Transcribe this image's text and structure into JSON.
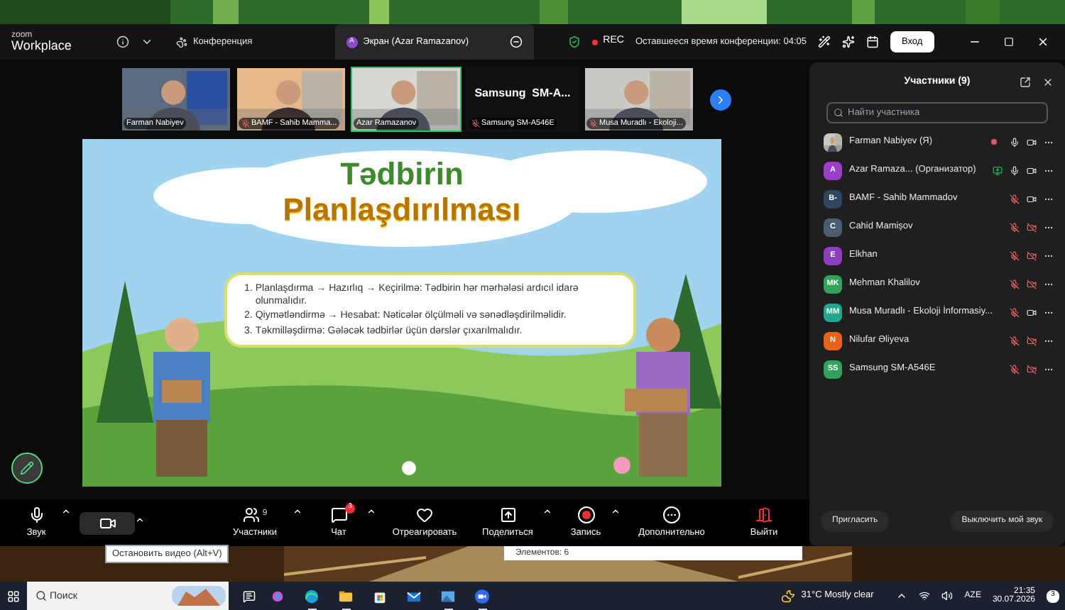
{
  "window": {
    "logo_top": "zoom",
    "logo_bottom": "Workplace",
    "conference_label": "Конференция",
    "share_tab": {
      "avatar": "A",
      "label": "Экран (Azar Ramazanov)"
    },
    "recording": "REC",
    "time_left": "Оставшееся время конференции: 04:05",
    "login_button": "Вход"
  },
  "video_strip": [
    {
      "kind": "video",
      "name": "Farman Nabiyev",
      "muted": false,
      "selected": false
    },
    {
      "kind": "video",
      "name": "BAMF - Sahib Mamma...",
      "muted": true,
      "selected": false
    },
    {
      "kind": "video",
      "name": "Azar Ramazanov",
      "muted": false,
      "selected": true
    },
    {
      "kind": "name_only",
      "title": "Samsung  SM-A...",
      "name": "Samsung SM-A546E",
      "muted": true,
      "selected": false
    },
    {
      "kind": "video",
      "name": "Musa Muradlı - Ekoloji...",
      "muted": true,
      "selected": false
    }
  ],
  "slide": {
    "title_line1": "Tədbirin",
    "title_line2": "Planlaşdırılması",
    "items": [
      {
        "number": "1.",
        "text": "Planlaşdırma → Hazırlıq → Keçirilmə: Tədbirin hər mərhələsi ardıcıl idarə olunmalıdır."
      },
      {
        "number": "2.",
        "text": "Qiymətləndirmə → Hesabat: Nəticələr ölçülməli və sənədləşdirilməlidir."
      },
      {
        "number": "3.",
        "text": "Təkmilləşdirmə: Gələcək tədbirlər üçün dərslər çıxarılmalıdır."
      }
    ]
  },
  "toolbar": [
    {
      "kind": "audio",
      "label": "Звук",
      "menu": true,
      "hovered": false
    },
    {
      "kind": "video",
      "tooltip": "Остановить видео (Alt+V)",
      "menu": true,
      "hovered": true
    },
    {
      "kind": "participants",
      "label": "Участники",
      "count": "9",
      "menu": true,
      "hovered": false
    },
    {
      "kind": "chat",
      "label": "Чат",
      "badge": "3",
      "menu": true,
      "hovered": false
    },
    {
      "kind": "react",
      "label": "Отреагировать",
      "menu": false,
      "hovered": false
    },
    {
      "kind": "share",
      "label": "Поделиться",
      "menu": true,
      "hovered": false
    },
    {
      "kind": "record",
      "label": "Запись",
      "menu": true,
      "hovered": false
    },
    {
      "kind": "more",
      "label": "Дополнительно",
      "menu": false,
      "hovered": false
    },
    {
      "kind": "leave",
      "label": "Выйти",
      "menu": false,
      "hovered": false
    }
  ],
  "participants_panel": {
    "title": "Участники (9)",
    "search": {
      "placeholder": "Найти участника"
    },
    "participants": [
      {
        "name": "Farman Nabiyev",
        "role": "(Я)",
        "dot": true,
        "sharing": false,
        "mic_muted": false,
        "video_on": true
      },
      {
        "name": "Azar Ramaza...",
        "role": "(Организатор)",
        "avatar": {
          "kind": "initials",
          "initials": "A",
          "color": "#9b3fc8"
        },
        "dot": false,
        "sharing": true,
        "mic_muted": false,
        "video_on": true
      },
      {
        "name": "BAMF - Sahib Mammadov",
        "avatar": {
          "kind": "initials",
          "initials": "B-",
          "color": "#2f4660"
        },
        "dot": false,
        "sharing": false,
        "mic_muted": true,
        "video_on": true
      },
      {
        "name": "Cahid Mamişov",
        "avatar": {
          "kind": "initials",
          "initials": "C",
          "color": "#4b5d6e"
        },
        "dot": false,
        "sharing": false,
        "mic_muted": true,
        "video_on": false
      },
      {
        "name": "Elkhan",
        "avatar": {
          "kind": "initials",
          "initials": "E",
          "color": "#8e3fc0"
        },
        "dot": false,
        "sharing": false,
        "mic_muted": true,
        "video_on": false
      },
      {
        "name": "Mehman Khalilov",
        "avatar": {
          "kind": "initials",
          "initials": "MK",
          "color": "#2fa35a"
        },
        "dot": false,
        "sharing": false,
        "mic_muted": true,
        "video_on": false
      },
      {
        "name": "Musa Muradlı - Ekoloji İnformasiy...",
        "avatar": {
          "kind": "initials",
          "initials": "MM",
          "color": "#1fa88c"
        },
        "dot": false,
        "sharing": false,
        "mic_muted": true,
        "video_on": true
      },
      {
        "name": "Nilufar Əliyeva",
        "avatar": {
          "kind": "initials",
          "initials": "N",
          "color": "#e8621a"
        },
        "dot": false,
        "sharing": false,
        "mic_muted": true,
        "video_on": false
      },
      {
        "name": "Samsung SM-A546E",
        "avatar": {
          "kind": "initials",
          "initials": "SS",
          "color": "#2fa35a"
        },
        "dot": false,
        "sharing": false,
        "mic_muted": true,
        "video_on": false
      }
    ],
    "buttons": [
      "Пригласить",
      "Выключить мой звук"
    ]
  },
  "desktop": {
    "explorer_status": "Элементов: 6"
  },
  "taskbar": {
    "search": {
      "placeholder": "Поиск"
    },
    "apps": [
      {
        "kind": "assistant",
        "running": false
      },
      {
        "kind": "browser",
        "running": true
      },
      {
        "kind": "folder",
        "running": true
      },
      {
        "kind": "store",
        "running": false
      },
      {
        "kind": "mail",
        "running": false
      },
      {
        "kind": "gallery",
        "running": true
      },
      {
        "kind": "meeting",
        "running": true
      }
    ],
    "weather": "31°C Mostly clear",
    "language": "AZE",
    "time": "21:35",
    "date": "30.07.2026",
    "notifications": "3"
  }
}
